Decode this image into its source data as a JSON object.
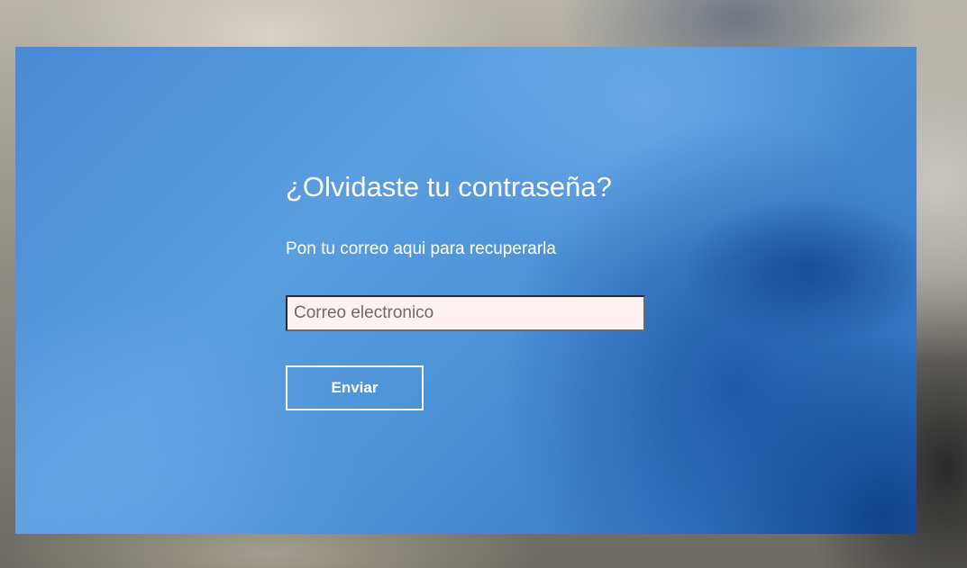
{
  "recovery": {
    "title": "¿Olvidaste tu contraseña?",
    "instructions": "Pon tu correo aqui para recuperarla",
    "email_placeholder": "Correo electronico",
    "email_value": "",
    "submit_label": "Enviar"
  },
  "colors": {
    "panel_blue": "#4a8ad4",
    "input_background": "#fdf2f2",
    "text": "#ffffff"
  }
}
